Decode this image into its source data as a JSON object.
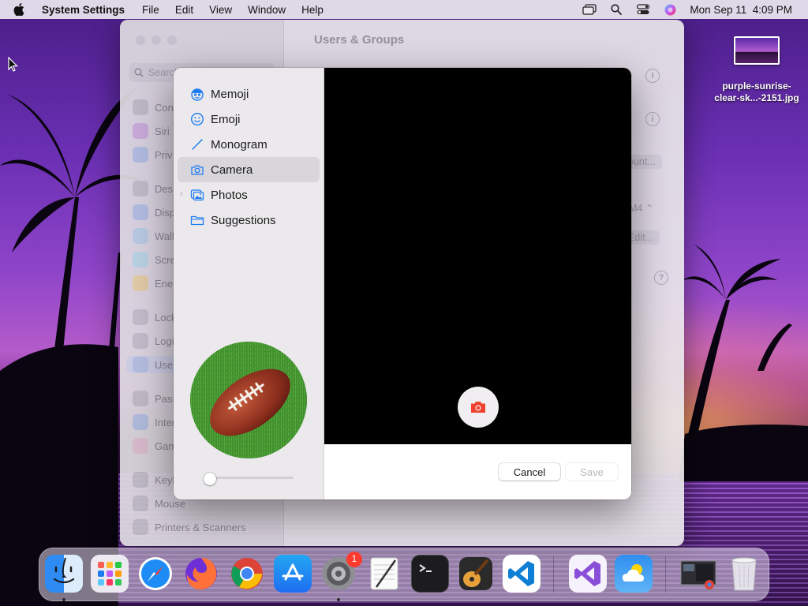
{
  "menubar": {
    "app_name": "System Settings",
    "menus": [
      "File",
      "Edit",
      "View",
      "Window",
      "Help"
    ],
    "clock": "Mon Sep 11  4:09 PM"
  },
  "desktop": {
    "file_name_line1": "purple-sunrise-",
    "file_name_line2": "clear-sk...-2151.jpg"
  },
  "settings_window": {
    "title": "Users & Groups",
    "search_placeholder": "Search",
    "sidebar_items": [
      "Con",
      "Siri",
      "Priv",
      "Desk",
      "Disp",
      "Wall",
      "Scre",
      "Ener",
      "Lock",
      "Logi",
      "Use",
      "Pass",
      "Inter",
      "Gam",
      "Keyb",
      "Mouse",
      "Printers & Scanners"
    ],
    "account_button": "ount...",
    "edit_button": "Edit...",
    "selector_value": "M4",
    "help": "?"
  },
  "picker": {
    "categories": [
      {
        "label": "Memoji",
        "icon": "memoji-icon"
      },
      {
        "label": "Emoji",
        "icon": "emoji-icon"
      },
      {
        "label": "Monogram",
        "icon": "monogram-icon"
      },
      {
        "label": "Camera",
        "icon": "camera-icon"
      },
      {
        "label": "Photos",
        "icon": "photos-icon"
      },
      {
        "label": "Suggestions",
        "icon": "folder-icon"
      }
    ],
    "selected": "Camera",
    "zoom": 0,
    "cancel_label": "Cancel",
    "save_label": "Save"
  },
  "dock": {
    "apps": [
      "Finder",
      "Launchpad",
      "Safari",
      "Firefox",
      "Chrome",
      "App Store",
      "System Settings",
      "TextEdit",
      "Terminal",
      "GarageBand",
      "Visual Studio Code",
      "Visual Studio",
      "Weather",
      "Screenshot",
      "Trash"
    ],
    "settings_badge": "1"
  },
  "colors": {
    "accent": "#1e7cf2",
    "shutter_red": "#f0412e"
  }
}
